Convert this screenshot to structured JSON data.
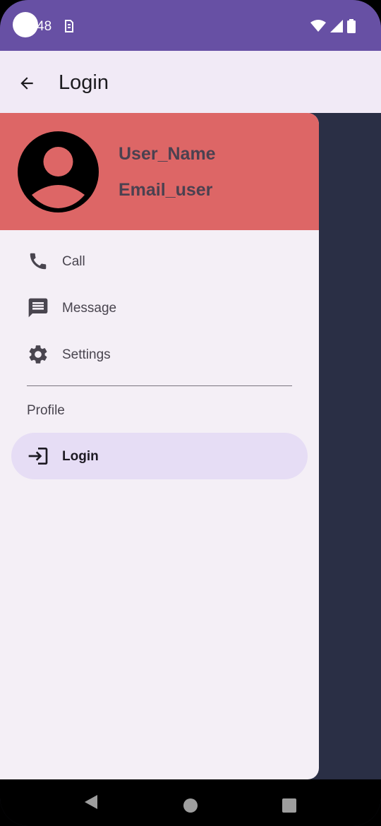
{
  "status_bar": {
    "time": "48",
    "icons": [
      "sim-icon",
      "wifi-icon",
      "signal-icon",
      "battery-icon"
    ]
  },
  "app_bar": {
    "title": "Login",
    "back_icon": "arrow-back-icon"
  },
  "drawer": {
    "header": {
      "user_name": "User_Name",
      "user_email": "Email_user",
      "avatar_icon": "account-circle-icon",
      "background_color": "#dd6666"
    },
    "items": [
      {
        "label": "Call",
        "icon": "phone-icon"
      },
      {
        "label": "Message",
        "icon": "message-icon"
      },
      {
        "label": "Settings",
        "icon": "gear-icon"
      }
    ],
    "section": {
      "label": "Profile",
      "items": [
        {
          "label": "Login",
          "icon": "login-icon",
          "selected": true
        }
      ]
    }
  },
  "colors": {
    "status_bar": "#6750a4",
    "app_bar": "#f1eaf6",
    "drawer": "#f4eff6",
    "selected_item": "#e6ddf5",
    "scrim": "#2a2f45"
  }
}
